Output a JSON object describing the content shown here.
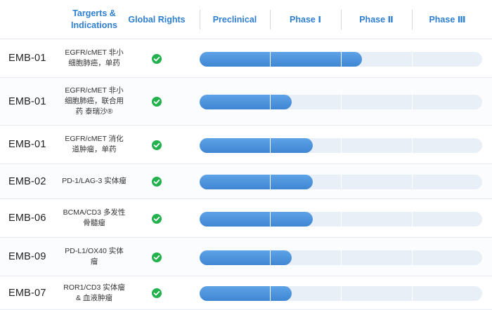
{
  "header": {
    "target_label": "Targerts &\nIndications",
    "rights_label": "Global Rights",
    "phases": [
      "Preclinical",
      "Phase Ⅰ",
      "Phase Ⅱ",
      "Phase Ⅲ"
    ]
  },
  "colors": {
    "header_text": "#2f7fd0",
    "bar_fill": "#4a90db",
    "bar_track": "#e9eff6",
    "check": "#22b14c"
  },
  "rows": [
    {
      "code": "EMB-01",
      "indication": "EGFR/cMET 非小\n细胞肺癌，单药",
      "global_rights": true,
      "progress_phase": 2.3
    },
    {
      "code": "EMB-01",
      "indication": "EGFR/cMET 非小\n细胞肺癌，联合用\n药 泰瑞沙®",
      "global_rights": true,
      "progress_phase": 1.3
    },
    {
      "code": "EMB-01",
      "indication": "EGFR/cMET 消化\n道肿瘤，单药",
      "global_rights": true,
      "progress_phase": 1.6
    },
    {
      "code": "EMB-02",
      "indication": "PD-1/LAG-3 实体瘤",
      "global_rights": true,
      "progress_phase": 1.6
    },
    {
      "code": "EMB-06",
      "indication": "BCMA/CD3 多发性\n骨髓瘤",
      "global_rights": true,
      "progress_phase": 1.6
    },
    {
      "code": "EMB-09",
      "indication": "PD-L1/OX40 实体\n瘤",
      "global_rights": true,
      "progress_phase": 1.3
    },
    {
      "code": "EMB-07",
      "indication": "ROR1/CD3 实体瘤\n& 血液肿瘤",
      "global_rights": true,
      "progress_phase": 1.3
    }
  ]
}
